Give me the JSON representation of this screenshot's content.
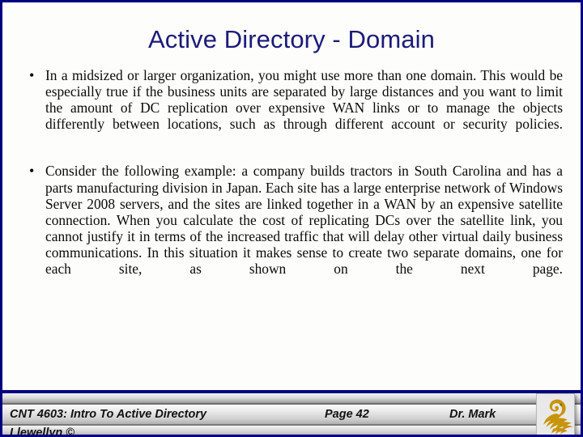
{
  "slide": {
    "title": "Active Directory - Domain",
    "title_color": "#1b1b7a",
    "border_color": "#000080",
    "background_color": "#fdfdfb"
  },
  "body": {
    "bullet_marker": "•",
    "bullets": [
      {
        "text": "In a midsized or larger organization, you might use more than one domain.   This would be especially true if the business units are separated by large distances and you want to limit the amount of DC replication over expensive WAN links or to manage the objects differently between locations, such as through different account or security policies."
      },
      {
        "text": "Consider the following example: a company builds tractors in South Carolina and has a parts manufacturing division in Japan.  Each site has a large enterprise network of Windows Server 2008 servers, and the sites are linked together in a WAN by an expensive satellite connection.  When you calculate the cost of replicating DCs over the satellite link, you cannot justify it in terms of the increased traffic that will delay other virtual daily business communications.  In this situation it makes sense to create two separate domains, one for each site, as shown on the next page."
      }
    ]
  },
  "footer": {
    "course": "CNT 4603: Intro To Active Directory",
    "page": "Page 42",
    "author": "Dr. Mark",
    "author_continued": "Llewellyn ©",
    "logo_name": "ucf-pegasus-logo",
    "logo_color": "#c8940a"
  }
}
